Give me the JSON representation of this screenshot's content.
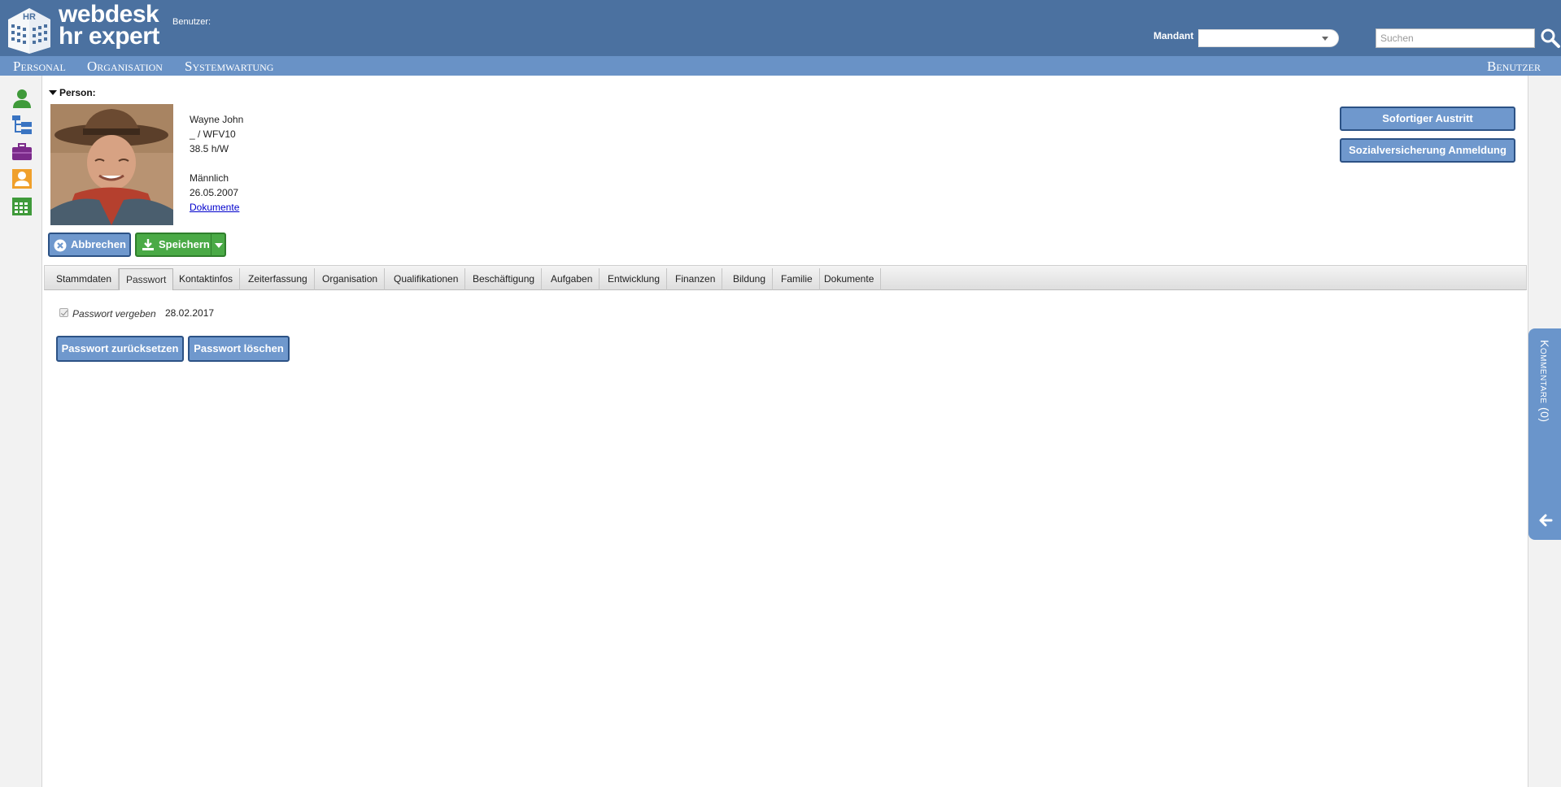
{
  "header": {
    "logo_line1": "webdesk",
    "logo_line2": "hr expert",
    "benutzer_label": "Benutzer:",
    "mandant_label": "Mandant",
    "mandant_value": "",
    "search_placeholder": "Suchen"
  },
  "menu": {
    "personal": "Personal",
    "organisation": "Organisation",
    "systemwartung": "Systemwartung",
    "benutzer": "Benutzer"
  },
  "person": {
    "section_label": "Person:",
    "name": "Wayne John",
    "code": "_ / WFV10",
    "hours": "38.5 h/W",
    "gender": "Männlich",
    "date": "26.05.2007",
    "documents_link": "Dokumente"
  },
  "actions": {
    "abbrechen": "Abbrechen",
    "speichern": "Speichern",
    "sofortiger_austritt": "Sofortiger Austritt",
    "sozialversicherung": "Sozialversicherung Anmeldung"
  },
  "tabs": [
    "Stammdaten",
    "Passwort",
    "Kontaktinfos",
    "Zeiterfassung",
    "Organisation",
    "Qualifikationen",
    "Beschäftigung",
    "Aufgaben",
    "Entwicklung",
    "Finanzen",
    "Bildung",
    "Familie",
    "Dokumente"
  ],
  "active_tab": "Passwort",
  "password": {
    "checkbox_label": "Passwort vergeben",
    "checked": true,
    "date": "28.02.2017",
    "reset_button": "Passwort zurücksetzen",
    "delete_button": "Passwort löschen"
  },
  "comments": {
    "label": "Kommentare (0)"
  },
  "colors": {
    "header_bg": "#4b71a0",
    "menubar_bg": "#6992c6",
    "button_blue": "#6f98cd",
    "button_green": "#4aaa46"
  }
}
